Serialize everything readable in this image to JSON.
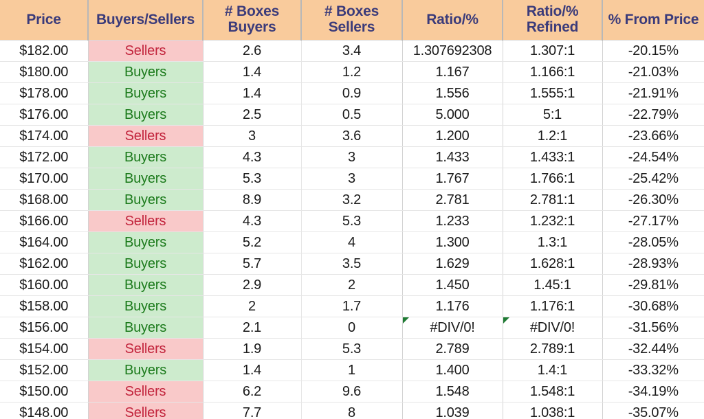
{
  "table": {
    "columns": [
      {
        "key": "price",
        "label": "Price"
      },
      {
        "key": "status",
        "label": "Buyers/Sellers"
      },
      {
        "key": "boxes_buyers",
        "label": "# Boxes\nBuyers"
      },
      {
        "key": "boxes_sellers",
        "label": "# Boxes\nSellers"
      },
      {
        "key": "ratio",
        "label": "Ratio/%"
      },
      {
        "key": "refined",
        "label": "Ratio/%\nRefined"
      },
      {
        "key": "from_price",
        "label": "% From Price"
      }
    ],
    "rows": [
      {
        "price": "$182.00",
        "status": "Sellers",
        "boxes_buyers": "2.6",
        "boxes_sellers": "3.4",
        "ratio": "1.307692308",
        "refined": "1.307:1",
        "from_price": "-20.15%",
        "error": false
      },
      {
        "price": "$180.00",
        "status": "Buyers",
        "boxes_buyers": "1.4",
        "boxes_sellers": "1.2",
        "ratio": "1.167",
        "refined": "1.166:1",
        "from_price": "-21.03%",
        "error": false
      },
      {
        "price": "$178.00",
        "status": "Buyers",
        "boxes_buyers": "1.4",
        "boxes_sellers": "0.9",
        "ratio": "1.556",
        "refined": "1.555:1",
        "from_price": "-21.91%",
        "error": false
      },
      {
        "price": "$176.00",
        "status": "Buyers",
        "boxes_buyers": "2.5",
        "boxes_sellers": "0.5",
        "ratio": "5.000",
        "refined": "5:1",
        "from_price": "-22.79%",
        "error": false
      },
      {
        "price": "$174.00",
        "status": "Sellers",
        "boxes_buyers": "3",
        "boxes_sellers": "3.6",
        "ratio": "1.200",
        "refined": "1.2:1",
        "from_price": "-23.66%",
        "error": false
      },
      {
        "price": "$172.00",
        "status": "Buyers",
        "boxes_buyers": "4.3",
        "boxes_sellers": "3",
        "ratio": "1.433",
        "refined": "1.433:1",
        "from_price": "-24.54%",
        "error": false
      },
      {
        "price": "$170.00",
        "status": "Buyers",
        "boxes_buyers": "5.3",
        "boxes_sellers": "3",
        "ratio": "1.767",
        "refined": "1.766:1",
        "from_price": "-25.42%",
        "error": false
      },
      {
        "price": "$168.00",
        "status": "Buyers",
        "boxes_buyers": "8.9",
        "boxes_sellers": "3.2",
        "ratio": "2.781",
        "refined": "2.781:1",
        "from_price": "-26.30%",
        "error": false
      },
      {
        "price": "$166.00",
        "status": "Sellers",
        "boxes_buyers": "4.3",
        "boxes_sellers": "5.3",
        "ratio": "1.233",
        "refined": "1.232:1",
        "from_price": "-27.17%",
        "error": false
      },
      {
        "price": "$164.00",
        "status": "Buyers",
        "boxes_buyers": "5.2",
        "boxes_sellers": "4",
        "ratio": "1.300",
        "refined": "1.3:1",
        "from_price": "-28.05%",
        "error": false
      },
      {
        "price": "$162.00",
        "status": "Buyers",
        "boxes_buyers": "5.7",
        "boxes_sellers": "3.5",
        "ratio": "1.629",
        "refined": "1.628:1",
        "from_price": "-28.93%",
        "error": false
      },
      {
        "price": "$160.00",
        "status": "Buyers",
        "boxes_buyers": "2.9",
        "boxes_sellers": "2",
        "ratio": "1.450",
        "refined": "1.45:1",
        "from_price": "-29.81%",
        "error": false
      },
      {
        "price": "$158.00",
        "status": "Buyers",
        "boxes_buyers": "2",
        "boxes_sellers": "1.7",
        "ratio": "1.176",
        "refined": "1.176:1",
        "from_price": "-30.68%",
        "error": false
      },
      {
        "price": "$156.00",
        "status": "Buyers",
        "boxes_buyers": "2.1",
        "boxes_sellers": "0",
        "ratio": "#DIV/0!",
        "refined": "#DIV/0!",
        "from_price": "-31.56%",
        "error": true
      },
      {
        "price": "$154.00",
        "status": "Sellers",
        "boxes_buyers": "1.9",
        "boxes_sellers": "5.3",
        "ratio": "2.789",
        "refined": "2.789:1",
        "from_price": "-32.44%",
        "error": false
      },
      {
        "price": "$152.00",
        "status": "Buyers",
        "boxes_buyers": "1.4",
        "boxes_sellers": "1",
        "ratio": "1.400",
        "refined": "1.4:1",
        "from_price": "-33.32%",
        "error": false
      },
      {
        "price": "$150.00",
        "status": "Sellers",
        "boxes_buyers": "6.2",
        "boxes_sellers": "9.6",
        "ratio": "1.548",
        "refined": "1.548:1",
        "from_price": "-34.19%",
        "error": false
      },
      {
        "price": "$148.00",
        "status": "Sellers",
        "boxes_buyers": "7.7",
        "boxes_sellers": "8",
        "ratio": "1.039",
        "refined": "1.038:1",
        "from_price": "-35.07%",
        "error": false
      }
    ]
  },
  "colors": {
    "header_bg": "#f9cb9c",
    "header_text": "#3b3b7a",
    "buyers_bg": "#cdebcd",
    "buyers_text": "#1b7a1b",
    "sellers_bg": "#f9c9c9",
    "sellers_text": "#c2243c",
    "error_flag": "#1e7a33",
    "grid_line": "#e6e6e6"
  }
}
